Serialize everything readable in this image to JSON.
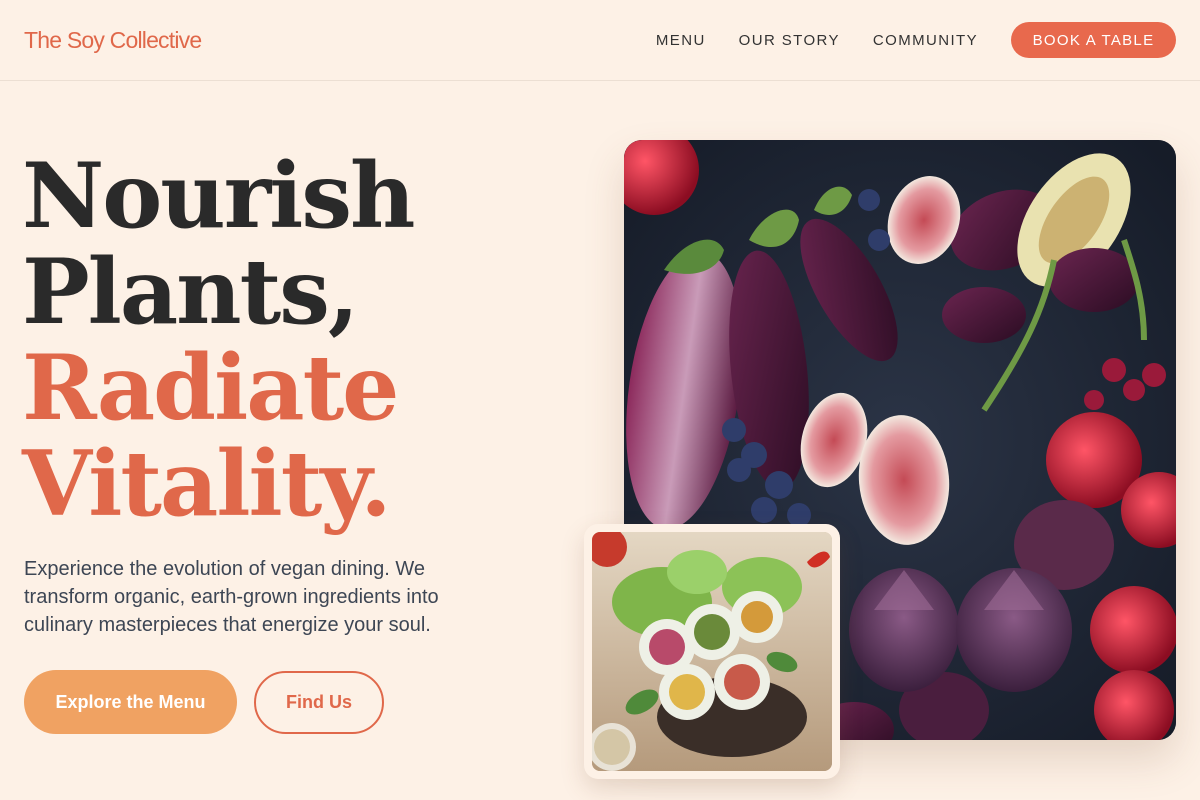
{
  "brand": {
    "name": "The Soy Collective"
  },
  "nav": {
    "items": [
      "MENU",
      "OUR STORY",
      "COMMUNITY"
    ],
    "cta": "BOOK A TABLE"
  },
  "hero": {
    "headline_line1": "Nourish",
    "headline_line2": "Plants,",
    "headline_line3": "Radiate",
    "headline_line4": "Vitality.",
    "description": "Experience the evolution of vegan dining. We transform organic, earth-grown ingredients into culinary masterpieces that energize your soul.",
    "primary_button": "Explore the Menu",
    "secondary_button": "Find Us"
  },
  "images": {
    "main": "produce-flatlay-image",
    "secondary": "spring-rolls-image"
  },
  "colors": {
    "background": "#fdf1e6",
    "accent": "#e0684a",
    "primary_button": "#f0a262",
    "text_dark": "#2a2a2a"
  }
}
